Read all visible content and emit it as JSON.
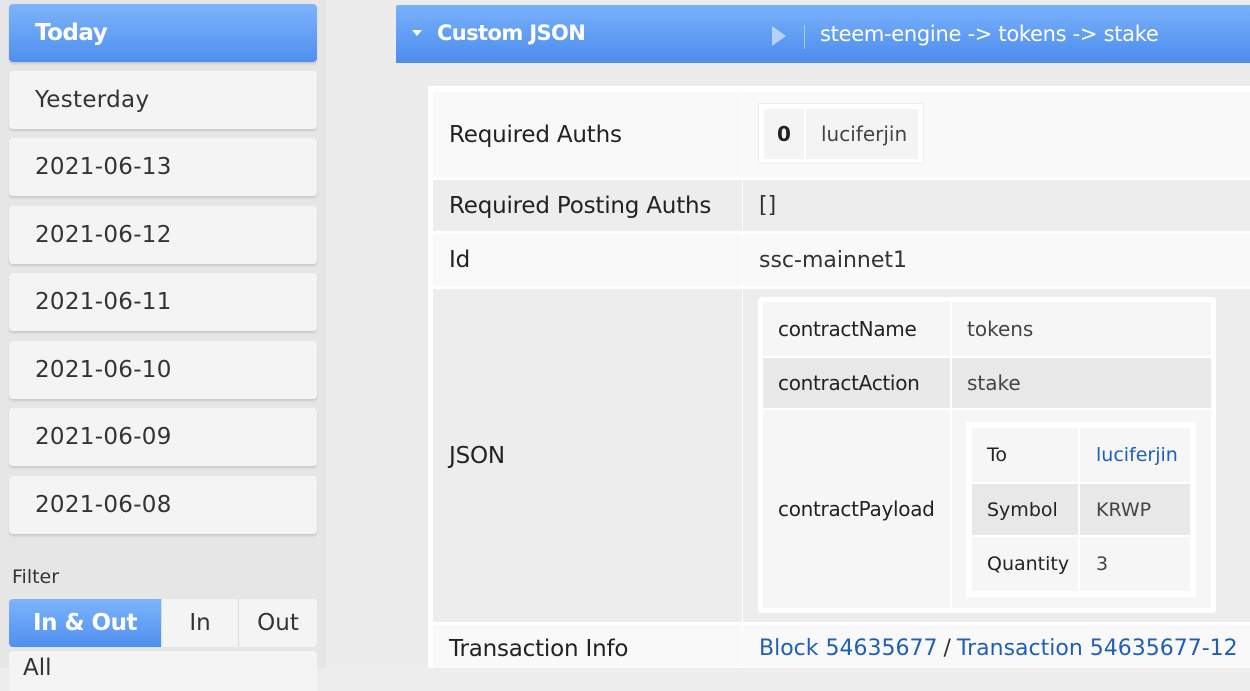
{
  "sidebar": {
    "days": [
      "Today",
      "Yesterday",
      "2021-06-13",
      "2021-06-12",
      "2021-06-11",
      "2021-06-10",
      "2021-06-09",
      "2021-06-08"
    ],
    "filter_label": "Filter",
    "filter_options": [
      "In & Out",
      "In",
      "Out"
    ],
    "next_item": "All"
  },
  "header": {
    "title": "Custom JSON",
    "path": "steem-engine -> tokens -> stake"
  },
  "operation": {
    "required_auths_label": "Required Auths",
    "required_auths": [
      {
        "index": "0",
        "name": "luciferjin"
      }
    ],
    "required_posting_auths_label": "Required Posting Auths",
    "required_posting_auths": "[]",
    "id_label": "Id",
    "id": "ssc-mainnet1",
    "json_label": "JSON",
    "json": {
      "contractName_label": "contractName",
      "contractName": "tokens",
      "contractAction_label": "contractAction",
      "contractAction": "stake",
      "contractPayload_label": "contractPayload",
      "payload": {
        "to_label": "To",
        "to": "luciferjin",
        "symbol_label": "Symbol",
        "symbol": "KRWP",
        "quantity_label": "Quantity",
        "quantity": "3"
      }
    },
    "transaction_info_label": "Transaction Info",
    "block_link": "Block 54635677",
    "separator": "/",
    "transaction_link": "Transaction 54635677-12"
  },
  "colors": {
    "accent": "#5b9af3",
    "link": "#1f5fb8"
  }
}
